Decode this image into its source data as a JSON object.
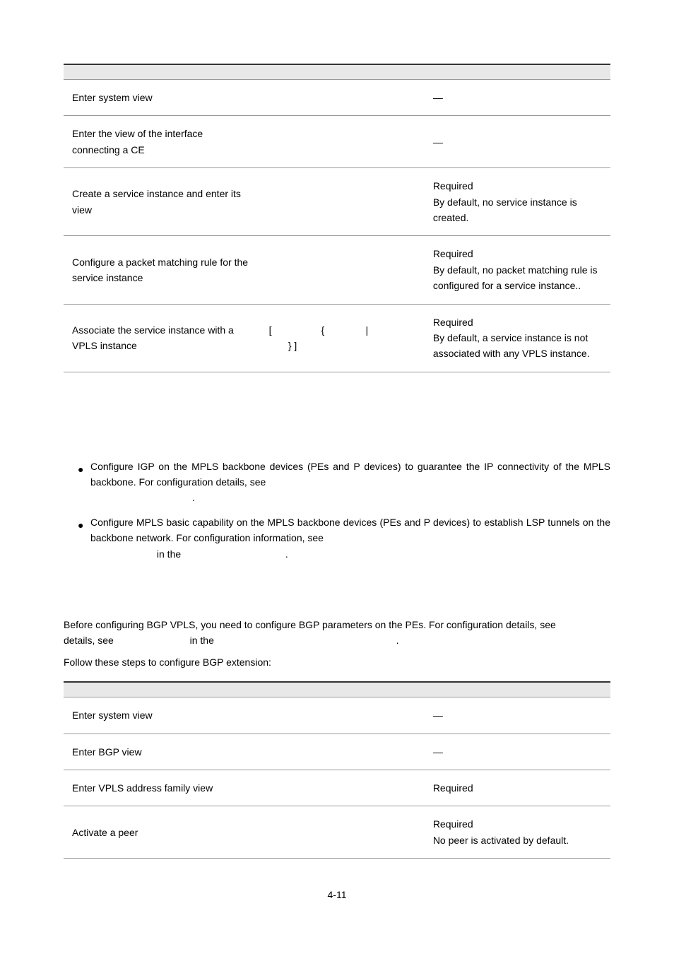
{
  "table1": {
    "rows": [
      {
        "a": "Enter system view",
        "b": "",
        "c": "—"
      },
      {
        "a": "Enter the view of the interface connecting a CE",
        "b": "",
        "c": "—"
      },
      {
        "a": "Create a service instance and enter its view",
        "b": "",
        "c": "Required\nBy default, no service instance is created."
      },
      {
        "a": "Configure a packet matching rule for the service instance",
        "b": "",
        "c": "Required\nBy default, no packet matching rule is configured for a service instance.."
      },
      {
        "a": "Associate the service instance with a VPLS instance",
        "b": "[                  {               |\n       } ]",
        "c": "Required\nBy default, a service instance is not associated with any VPLS instance."
      }
    ]
  },
  "bullets": [
    {
      "text": "Configure IGP on the MPLS backbone devices (PEs and P devices) to guarantee the IP connectivity of the MPLS backbone. For configuration details, see ",
      "tail": "."
    },
    {
      "text": "Configure MPLS basic capability on the MPLS backbone devices (PEs and P devices) to establish LSP tunnels on the backbone network. For configuration information, see ",
      "mid": " in the ",
      "tail": "."
    }
  ],
  "paragraph": {
    "p1a": "Before configuring BGP VPLS, you need to configure BGP parameters on the PEs. For configuration details, see ",
    "p1b": " in the ",
    "p1c": ".",
    "p2": "Follow these steps to configure BGP extension:"
  },
  "table2": {
    "rows": [
      {
        "a": "Enter system view",
        "b": "",
        "c": "—"
      },
      {
        "a": "Enter BGP view",
        "b": "",
        "c": "—"
      },
      {
        "a": "Enter VPLS address family view",
        "b": "",
        "c": "Required"
      },
      {
        "a": "Activate a peer",
        "b": "",
        "c": "Required\nNo peer is activated by default."
      }
    ]
  },
  "pageNumber": "4-11"
}
